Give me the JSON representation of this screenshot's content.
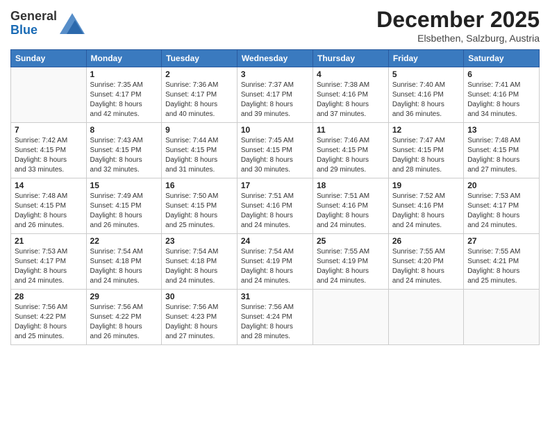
{
  "header": {
    "logo_general": "General",
    "logo_blue": "Blue",
    "month_title": "December 2025",
    "location": "Elsbethen, Salzburg, Austria"
  },
  "days_of_week": [
    "Sunday",
    "Monday",
    "Tuesday",
    "Wednesday",
    "Thursday",
    "Friday",
    "Saturday"
  ],
  "weeks": [
    [
      {
        "day": "",
        "info": ""
      },
      {
        "day": "1",
        "info": "Sunrise: 7:35 AM\nSunset: 4:17 PM\nDaylight: 8 hours\nand 42 minutes."
      },
      {
        "day": "2",
        "info": "Sunrise: 7:36 AM\nSunset: 4:17 PM\nDaylight: 8 hours\nand 40 minutes."
      },
      {
        "day": "3",
        "info": "Sunrise: 7:37 AM\nSunset: 4:17 PM\nDaylight: 8 hours\nand 39 minutes."
      },
      {
        "day": "4",
        "info": "Sunrise: 7:38 AM\nSunset: 4:16 PM\nDaylight: 8 hours\nand 37 minutes."
      },
      {
        "day": "5",
        "info": "Sunrise: 7:40 AM\nSunset: 4:16 PM\nDaylight: 8 hours\nand 36 minutes."
      },
      {
        "day": "6",
        "info": "Sunrise: 7:41 AM\nSunset: 4:16 PM\nDaylight: 8 hours\nand 34 minutes."
      }
    ],
    [
      {
        "day": "7",
        "info": "Sunrise: 7:42 AM\nSunset: 4:15 PM\nDaylight: 8 hours\nand 33 minutes."
      },
      {
        "day": "8",
        "info": "Sunrise: 7:43 AM\nSunset: 4:15 PM\nDaylight: 8 hours\nand 32 minutes."
      },
      {
        "day": "9",
        "info": "Sunrise: 7:44 AM\nSunset: 4:15 PM\nDaylight: 8 hours\nand 31 minutes."
      },
      {
        "day": "10",
        "info": "Sunrise: 7:45 AM\nSunset: 4:15 PM\nDaylight: 8 hours\nand 30 minutes."
      },
      {
        "day": "11",
        "info": "Sunrise: 7:46 AM\nSunset: 4:15 PM\nDaylight: 8 hours\nand 29 minutes."
      },
      {
        "day": "12",
        "info": "Sunrise: 7:47 AM\nSunset: 4:15 PM\nDaylight: 8 hours\nand 28 minutes."
      },
      {
        "day": "13",
        "info": "Sunrise: 7:48 AM\nSunset: 4:15 PM\nDaylight: 8 hours\nand 27 minutes."
      }
    ],
    [
      {
        "day": "14",
        "info": "Sunrise: 7:48 AM\nSunset: 4:15 PM\nDaylight: 8 hours\nand 26 minutes."
      },
      {
        "day": "15",
        "info": "Sunrise: 7:49 AM\nSunset: 4:15 PM\nDaylight: 8 hours\nand 26 minutes."
      },
      {
        "day": "16",
        "info": "Sunrise: 7:50 AM\nSunset: 4:15 PM\nDaylight: 8 hours\nand 25 minutes."
      },
      {
        "day": "17",
        "info": "Sunrise: 7:51 AM\nSunset: 4:16 PM\nDaylight: 8 hours\nand 24 minutes."
      },
      {
        "day": "18",
        "info": "Sunrise: 7:51 AM\nSunset: 4:16 PM\nDaylight: 8 hours\nand 24 minutes."
      },
      {
        "day": "19",
        "info": "Sunrise: 7:52 AM\nSunset: 4:16 PM\nDaylight: 8 hours\nand 24 minutes."
      },
      {
        "day": "20",
        "info": "Sunrise: 7:53 AM\nSunset: 4:17 PM\nDaylight: 8 hours\nand 24 minutes."
      }
    ],
    [
      {
        "day": "21",
        "info": "Sunrise: 7:53 AM\nSunset: 4:17 PM\nDaylight: 8 hours\nand 24 minutes."
      },
      {
        "day": "22",
        "info": "Sunrise: 7:54 AM\nSunset: 4:18 PM\nDaylight: 8 hours\nand 24 minutes."
      },
      {
        "day": "23",
        "info": "Sunrise: 7:54 AM\nSunset: 4:18 PM\nDaylight: 8 hours\nand 24 minutes."
      },
      {
        "day": "24",
        "info": "Sunrise: 7:54 AM\nSunset: 4:19 PM\nDaylight: 8 hours\nand 24 minutes."
      },
      {
        "day": "25",
        "info": "Sunrise: 7:55 AM\nSunset: 4:19 PM\nDaylight: 8 hours\nand 24 minutes."
      },
      {
        "day": "26",
        "info": "Sunrise: 7:55 AM\nSunset: 4:20 PM\nDaylight: 8 hours\nand 24 minutes."
      },
      {
        "day": "27",
        "info": "Sunrise: 7:55 AM\nSunset: 4:21 PM\nDaylight: 8 hours\nand 25 minutes."
      }
    ],
    [
      {
        "day": "28",
        "info": "Sunrise: 7:56 AM\nSunset: 4:22 PM\nDaylight: 8 hours\nand 25 minutes."
      },
      {
        "day": "29",
        "info": "Sunrise: 7:56 AM\nSunset: 4:22 PM\nDaylight: 8 hours\nand 26 minutes."
      },
      {
        "day": "30",
        "info": "Sunrise: 7:56 AM\nSunset: 4:23 PM\nDaylight: 8 hours\nand 27 minutes."
      },
      {
        "day": "31",
        "info": "Sunrise: 7:56 AM\nSunset: 4:24 PM\nDaylight: 8 hours\nand 28 minutes."
      },
      {
        "day": "",
        "info": ""
      },
      {
        "day": "",
        "info": ""
      },
      {
        "day": "",
        "info": ""
      }
    ]
  ]
}
